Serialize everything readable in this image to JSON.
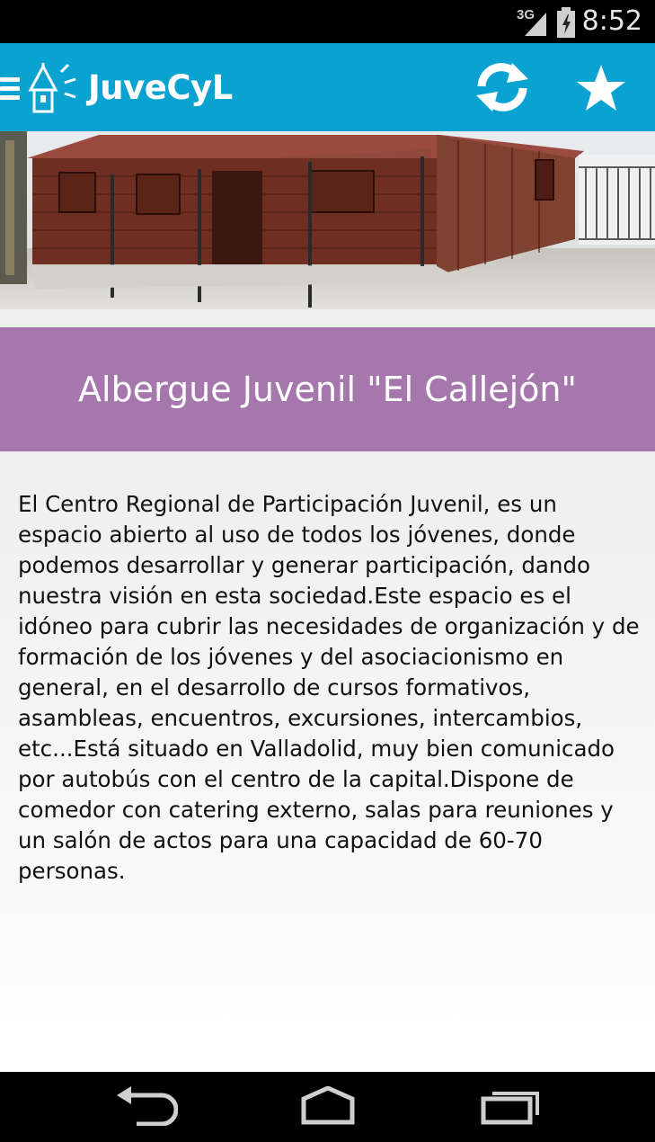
{
  "status_bar": {
    "network": "3G",
    "time": "8:52"
  },
  "app_bar": {
    "title": "JuveCyL"
  },
  "hero": {
    "image_label": "hostel building photo"
  },
  "heading": {
    "title": "Albergue Juvenil \"El Callejón\""
  },
  "content": {
    "description": "El Centro Regional de Participación Juvenil, es un espacio abierto al uso de todos los jóvenes, donde podemos desarrollar y generar participación, dando nuestra visión en esta sociedad.Este espacio es el idóneo para cubrir las necesidades de organización y de formación de los jóvenes y del asociacionismo en general, en el desarrollo de cursos formativos, asambleas, encuentros, excursiones, intercambios, etc...Está situado en Valladolid, muy bien comunicado por autobús con el centro de la capital.Dispone de comedor con catering externo, salas para reuniones y un salón de actos para una capacidad de 60-70 personas."
  },
  "nav_bar": {
    "icons": [
      "back-icon",
      "home-icon",
      "recent-apps-icon"
    ]
  },
  "colors": {
    "app_bar": "#0aa3d1",
    "heading_band": "#a577ad",
    "status_bar": "#000000"
  }
}
